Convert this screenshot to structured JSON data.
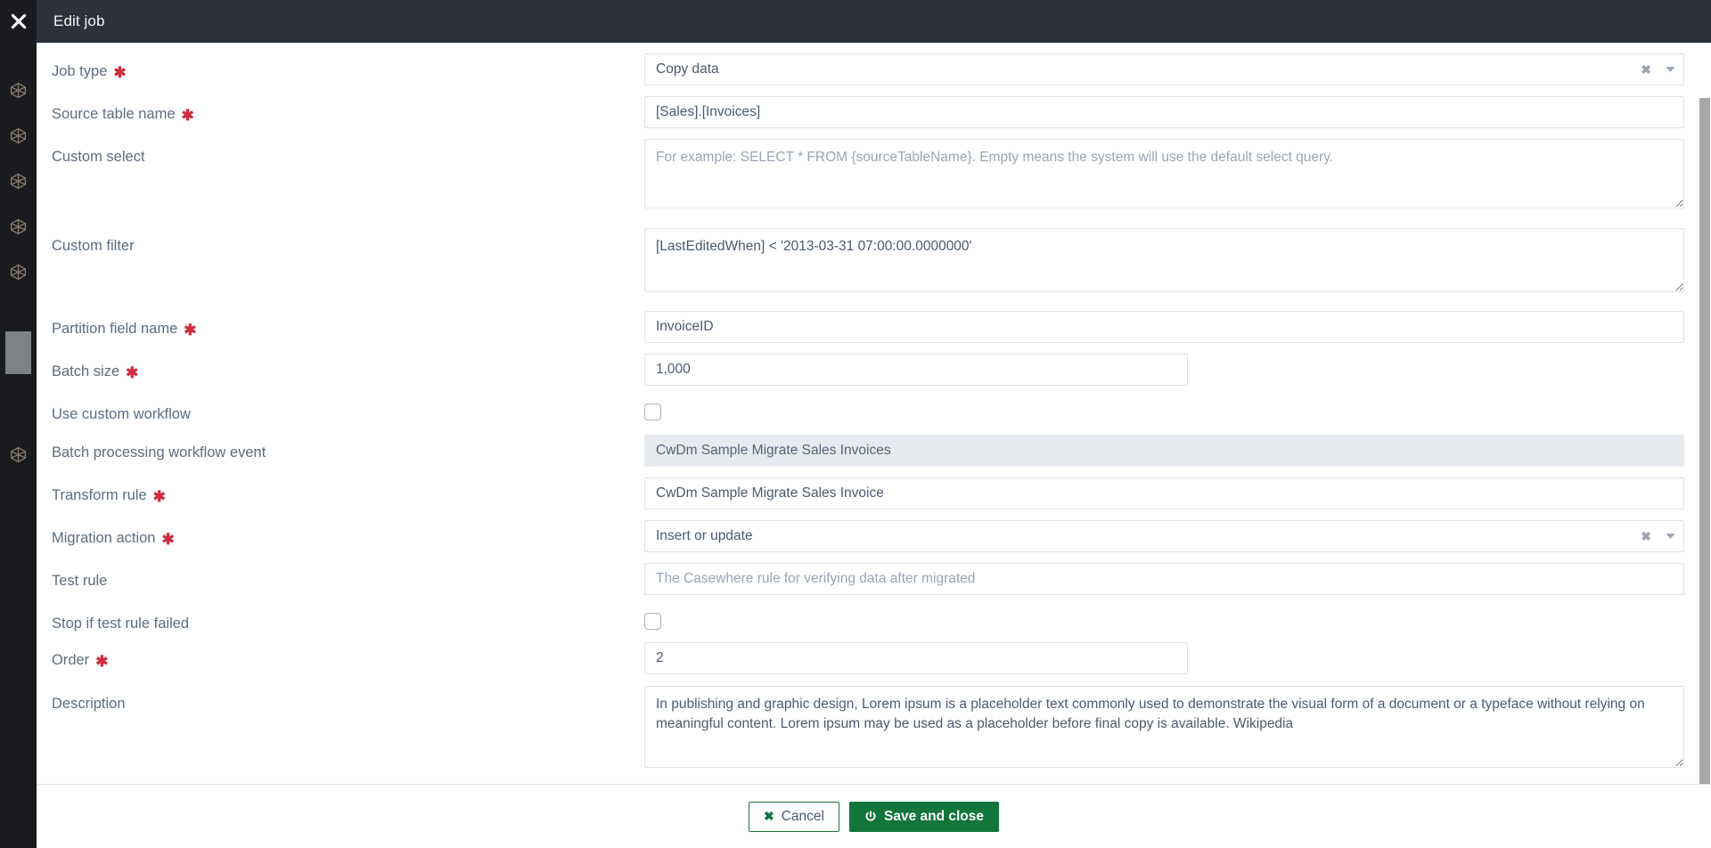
{
  "window": {
    "title": "Edit job",
    "close_icon": "close-icon"
  },
  "sidebar": {
    "items": [
      {
        "icon": "cube-icon",
        "name": "rail-item-1"
      },
      {
        "icon": "cube-icon",
        "name": "rail-item-2"
      },
      {
        "icon": "cube-icon",
        "name": "rail-item-3"
      },
      {
        "icon": "cube-icon",
        "name": "rail-item-4"
      },
      {
        "icon": "cube-icon",
        "name": "rail-item-5"
      },
      {
        "icon": "cube-icon",
        "name": "rail-item-6"
      }
    ]
  },
  "form": {
    "job_type": {
      "label": "Job type",
      "required": true,
      "value": "Copy data",
      "clear_icon": "✖",
      "caret_icon": "chevron-down-icon"
    },
    "source_table_name": {
      "label": "Source table name",
      "required": true,
      "value": "[Sales].[Invoices]"
    },
    "custom_select": {
      "label": "Custom select",
      "required": false,
      "value": "",
      "placeholder": "For example: SELECT * FROM {sourceTableName}. Empty means the system will use the default select query."
    },
    "custom_filter": {
      "label": "Custom filter",
      "required": false,
      "value": "[LastEditedWhen] < '2013-03-31 07:00:00.0000000'"
    },
    "partition_field_name": {
      "label": "Partition field name",
      "required": true,
      "value": "InvoiceID"
    },
    "batch_size": {
      "label": "Batch size",
      "required": true,
      "value": "1,000"
    },
    "use_custom_workflow": {
      "label": "Use custom workflow",
      "required": false,
      "checked": false
    },
    "batch_processing_workflow_event": {
      "label": "Batch processing workflow event",
      "required": false,
      "value": "CwDm Sample Migrate Sales Invoices",
      "disabled": true
    },
    "transform_rule": {
      "label": "Transform rule",
      "required": true,
      "value": "CwDm Sample Migrate Sales Invoice"
    },
    "migration_action": {
      "label": "Migration action",
      "required": true,
      "value": "Insert or update",
      "clear_icon": "✖",
      "caret_icon": "chevron-down-icon"
    },
    "test_rule": {
      "label": "Test rule",
      "required": false,
      "value": "",
      "placeholder": "The Casewhere rule for verifying data after migrated"
    },
    "stop_if_test_rule_failed": {
      "label": "Stop if test rule failed",
      "required": false,
      "checked": false
    },
    "order": {
      "label": "Order",
      "required": true,
      "value": "2"
    },
    "description": {
      "label": "Description",
      "required": false,
      "value": "In publishing and graphic design, Lorem ipsum is a placeholder text commonly used to demonstrate the visual form of a document or a typeface without relying on meaningful content. Lorem ipsum may be used as a placeholder before final copy is available. Wikipedia"
    }
  },
  "footer": {
    "cancel_label": "Cancel",
    "cancel_icon": "✖",
    "save_label": "Save and close",
    "save_icon": "power-icon"
  },
  "colors": {
    "titlebar": "#2c313a",
    "rail": "#191b1f",
    "accent_green": "#12753c",
    "required_red": "#cf2d3f",
    "label_text": "#5d6c7f"
  }
}
